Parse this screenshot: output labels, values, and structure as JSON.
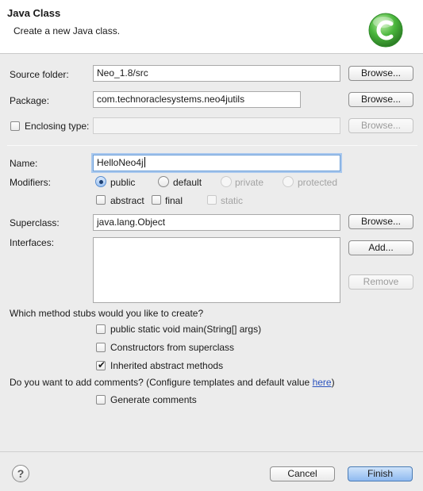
{
  "header": {
    "title": "Java Class",
    "description": "Create a new Java class."
  },
  "source_folder": {
    "label": "Source folder:",
    "value": "Neo_1.8/src",
    "browse_label": "Browse..."
  },
  "package": {
    "label": "Package:",
    "value": "com.technoraclesystems.neo4jutils",
    "browse_label": "Browse..."
  },
  "enclosing_type": {
    "label": "Enclosing type:",
    "checked": false,
    "value": "",
    "browse_label": "Browse..."
  },
  "name": {
    "label": "Name:",
    "value": "HelloNeo4j"
  },
  "modifiers": {
    "label": "Modifiers:",
    "access": [
      {
        "label": "public",
        "selected": true,
        "enabled": true
      },
      {
        "label": "default",
        "selected": false,
        "enabled": true
      },
      {
        "label": "private",
        "selected": false,
        "enabled": false
      },
      {
        "label": "protected",
        "selected": false,
        "enabled": false
      }
    ],
    "flags": [
      {
        "label": "abstract",
        "checked": false,
        "enabled": true
      },
      {
        "label": "final",
        "checked": false,
        "enabled": true
      },
      {
        "label": "static",
        "checked": false,
        "enabled": false
      }
    ]
  },
  "superclass": {
    "label": "Superclass:",
    "value": "java.lang.Object",
    "browse_label": "Browse..."
  },
  "interfaces": {
    "label": "Interfaces:",
    "add_label": "Add...",
    "remove_label": "Remove",
    "items": []
  },
  "method_stubs": {
    "question": "Which method stubs would you like to create?",
    "options": [
      {
        "label": "public static void main(String[] args)",
        "checked": false
      },
      {
        "label": "Constructors from superclass",
        "checked": false
      },
      {
        "label": "Inherited abstract methods",
        "checked": true
      }
    ]
  },
  "comments": {
    "question_prefix": "Do you want to add comments? (Configure templates and default value ",
    "link_text": "here",
    "question_suffix": ")",
    "option_label": "Generate comments",
    "checked": false
  },
  "footer": {
    "help_glyph": "?",
    "cancel_label": "Cancel",
    "finish_label": "Finish"
  },
  "colors": {
    "accent": "#8fbaf0",
    "link": "#2a52be",
    "logo_green": "#49b53c"
  },
  "icons": {
    "class_logo": "java-class-logo-icon",
    "help": "help-icon",
    "checkmark": "checkmark-icon"
  }
}
